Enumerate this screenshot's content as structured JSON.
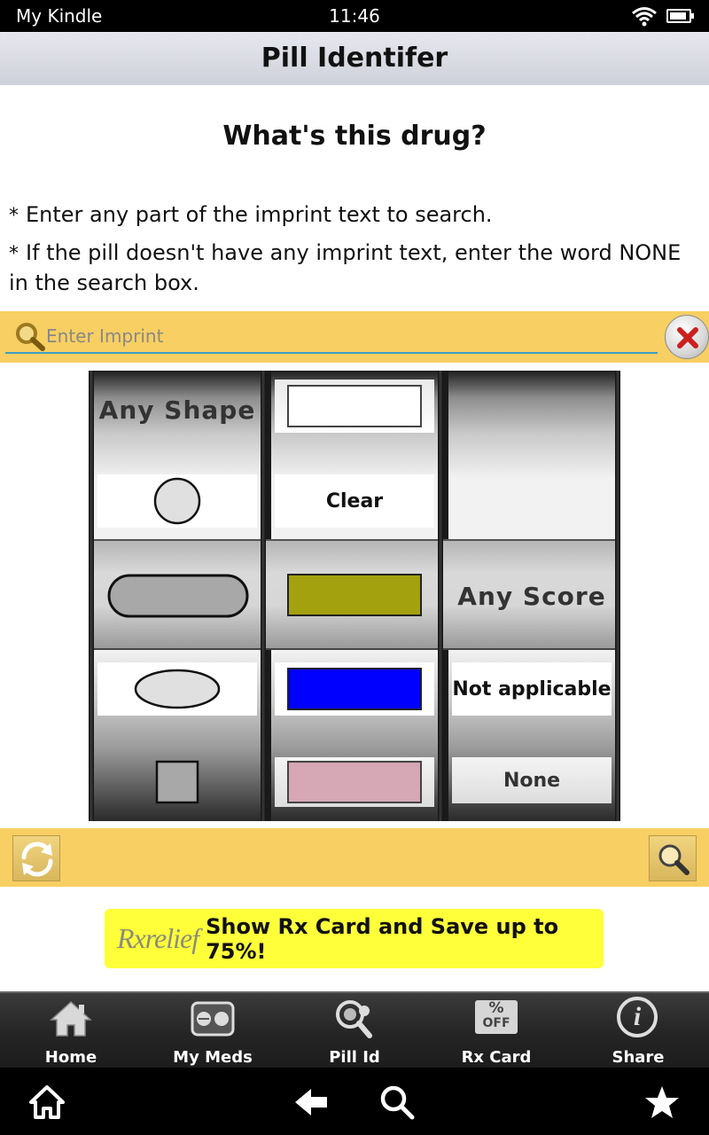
{
  "status_bar": {
    "device_label": "My Kindle",
    "time": "11:46",
    "wifi_icon": "wifi-icon",
    "battery_icon": "battery-icon"
  },
  "title_bar": {
    "title": "Pill Identifer"
  },
  "main": {
    "heading": "What's this drug?",
    "instructions": [
      "Enter any part of the imprint text to search.",
      "If the pill doesn't have any imprint text, enter the word NONE in the search box."
    ],
    "bullet": "*"
  },
  "search": {
    "placeholder": "Enter Imprint",
    "value": "",
    "search_icon": "magnifier-icon",
    "clear_icon": "close-icon"
  },
  "picker": {
    "shape_column": {
      "items": [
        "Any Shape",
        "round",
        "capsule-oblong",
        "oval",
        "square"
      ],
      "selected": "capsule-oblong"
    },
    "color_column": {
      "items": [
        "white",
        "Clear",
        "olive",
        "blue",
        "pink"
      ],
      "selected": "olive",
      "label_clear": "Clear",
      "swatches": {
        "white": "#ffffff",
        "olive": "#a3a10e",
        "blue": "#0000ff",
        "pink": "#d6a7b4"
      }
    },
    "score_column": {
      "items": [
        "Any Score",
        "Not applicable",
        "None"
      ],
      "selected": "Any Score"
    }
  },
  "actions": {
    "reset_icon": "refresh-icon",
    "search_icon": "magnifier-icon"
  },
  "promo": {
    "logo_text": "Rxrelief",
    "text": "Show Rx Card and Save up to 75%!",
    "background": "#ffff3a"
  },
  "tab_bar": {
    "tabs": [
      {
        "label": "Home",
        "icon": "home-icon"
      },
      {
        "label": "My Meds",
        "icon": "pill-box-icon"
      },
      {
        "label": "Pill Id",
        "icon": "pill-search-icon"
      },
      {
        "label": "Rx Card",
        "icon": "percent-off-icon"
      },
      {
        "label": "Share",
        "icon": "info-icon"
      }
    ],
    "off_label": "OFF",
    "percent_label": "%",
    "info_glyph": "i"
  },
  "nav_bar": {
    "buttons": [
      "home-icon",
      "back-icon",
      "search-icon",
      "star-icon"
    ]
  },
  "colors": {
    "accent_yellow": "#f7cf62",
    "input_underline": "#3aa0c4",
    "clear_x": "#cc1f1f"
  }
}
